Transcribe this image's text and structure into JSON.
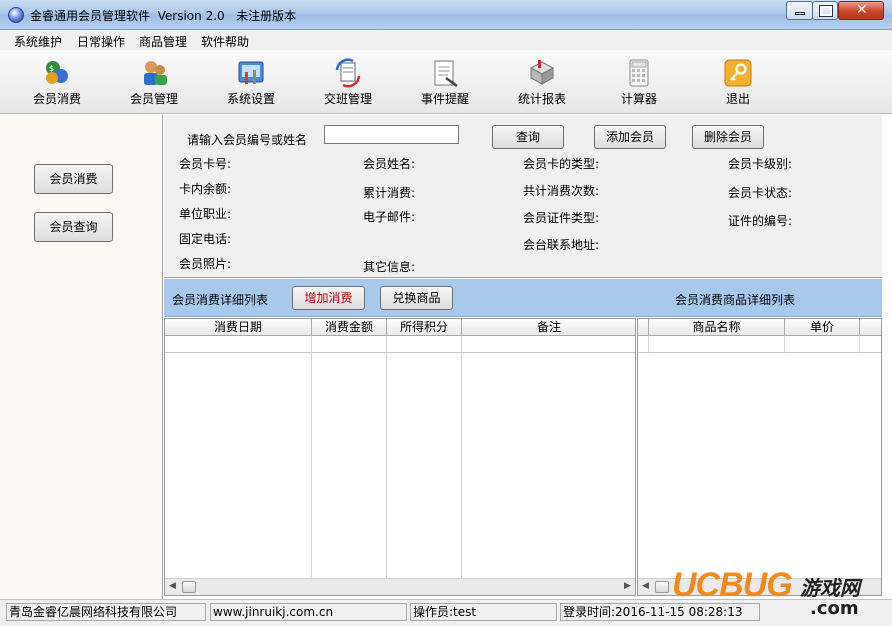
{
  "window": {
    "title": "金睿通用会员管理软件  Version 2.0   未注册版本"
  },
  "menu": [
    "系统维护",
    "日常操作",
    "商品管理",
    "软件帮助"
  ],
  "toolbar": [
    {
      "label": "会员消费",
      "icon": "member-consume-icon"
    },
    {
      "label": "会员管理",
      "icon": "member-manage-icon"
    },
    {
      "label": "系统设置",
      "icon": "system-settings-icon"
    },
    {
      "label": "交班管理",
      "icon": "shift-manage-icon"
    },
    {
      "label": "事件提醒",
      "icon": "event-reminder-icon"
    },
    {
      "label": "统计报表",
      "icon": "statistics-report-icon"
    },
    {
      "label": "计算器",
      "icon": "calculator-icon"
    },
    {
      "label": "退出",
      "icon": "exit-key-icon"
    }
  ],
  "left_panel": {
    "consume_button": "会员消费",
    "query_button": "会员查询"
  },
  "search": {
    "prompt": "请输入会员编号或姓名",
    "value": "",
    "query_button": "查询",
    "add_button": "添加会员",
    "delete_button": "删除会员"
  },
  "fields": {
    "card_no": "会员卡号:",
    "balance": "卡内余额:",
    "occupation": "单位职业:",
    "phone": "固定电话:",
    "photo": "会员照片:",
    "name": "会员姓名:",
    "total_consume": "累计消费:",
    "email": "电子邮件:",
    "other_info": "其它信息:",
    "card_type": "会员卡的类型:",
    "consume_count": "共计消费次数:",
    "id_type": "会员证件类型:",
    "address": "会台联系地址:",
    "card_level": "会员卡级别:",
    "card_status": "会员卡状态:",
    "id_number": "证件的编号:"
  },
  "list_bar": {
    "left_title": "会员消费详细列表",
    "add_consume_button": "增加消费",
    "exchange_button": "兑换商品",
    "right_title": "会员消费商品详细列表"
  },
  "consume_table": {
    "columns": [
      "消费日期",
      "消费金额",
      "所得积分",
      "备注"
    ]
  },
  "goods_table": {
    "columns": [
      "商品名称",
      "单价"
    ]
  },
  "status_bar": {
    "company": "青岛金睿亿晨网络科技有限公司",
    "website": "www.jinruikj.com.cn",
    "operator": "操作员:test",
    "login_time": "登录时间:2016-11-15 08:28:13"
  },
  "watermark": {
    "brand": "UCBUG",
    "suffix": "游戏网",
    "domain": ".com"
  },
  "colors": {
    "list_bar": "#a8c8ec",
    "add_consume_text": "#c00000",
    "watermark_orange": "#f08a1e"
  }
}
